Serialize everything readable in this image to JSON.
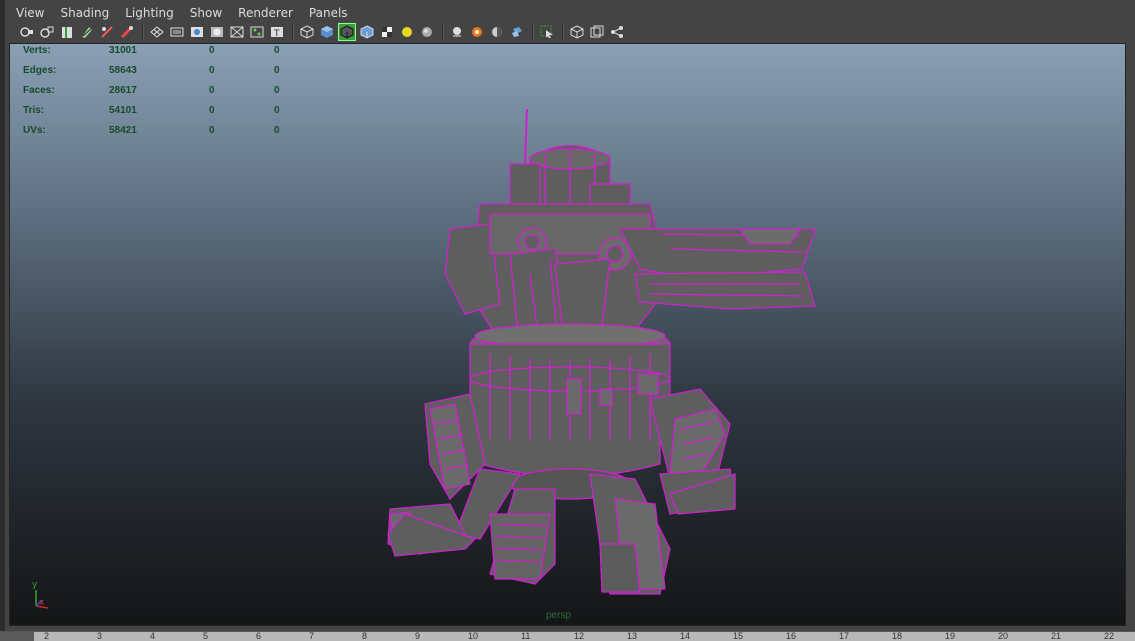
{
  "menu": {
    "items": [
      "View",
      "Shading",
      "Lighting",
      "Show",
      "Renderer",
      "Panels"
    ]
  },
  "toolbar": {
    "groups": [
      [
        "select-camera-icon",
        "lock-camera-icon",
        "bookmark-icon",
        "image-plane-icon",
        "grease-pencil-icon",
        "two-d-pan-icon"
      ],
      [
        "grid-icon",
        "film-gate-icon",
        "resolution-gate-icon",
        "gate-mask-icon",
        "field-chart-icon",
        "safe-action-icon",
        "safe-title-icon"
      ],
      [
        "wireframe-icon",
        "smooth-shade-icon",
        "wireframe-on-shaded-icon",
        "default-material-icon",
        "textured-icon",
        "use-all-lights-icon",
        "shadows-icon"
      ],
      [
        "xray-icon",
        "xray-joints-icon",
        "xray-components-icon",
        "backface-culling-icon"
      ],
      [
        "isolate-select-icon"
      ],
      [
        "hud-icon",
        "two-pane-icon",
        "node-editor-icon"
      ]
    ],
    "active_icon": "wireframe-on-shaded-icon",
    "accent_color": "#3a9d3a"
  },
  "hud": {
    "rows": [
      {
        "label": "Verts:",
        "v1": "31001",
        "v2": "0",
        "v3": "0"
      },
      {
        "label": "Edges:",
        "v1": "58643",
        "v2": "0",
        "v3": "0"
      },
      {
        "label": "Faces:",
        "v1": "28617",
        "v2": "0",
        "v3": "0"
      },
      {
        "label": "Tris:",
        "v1": "54101",
        "v2": "0",
        "v3": "0"
      },
      {
        "label": "UVs:",
        "v1": "58421",
        "v2": "0",
        "v3": "0"
      }
    ],
    "text_color": "#184a2a"
  },
  "viewport": {
    "camera_label": "persp",
    "selection_wire_color": "#cc22cc",
    "model_fill_color": "#5e5e5e",
    "axis": {
      "y": "y",
      "x": "x"
    }
  },
  "timeline": {
    "ticks": [
      "2",
      "3",
      "4",
      "5",
      "6",
      "7",
      "8",
      "9",
      "10",
      "11",
      "12",
      "13",
      "14",
      "15",
      "16",
      "17",
      "18",
      "19",
      "20",
      "21",
      "22"
    ]
  }
}
